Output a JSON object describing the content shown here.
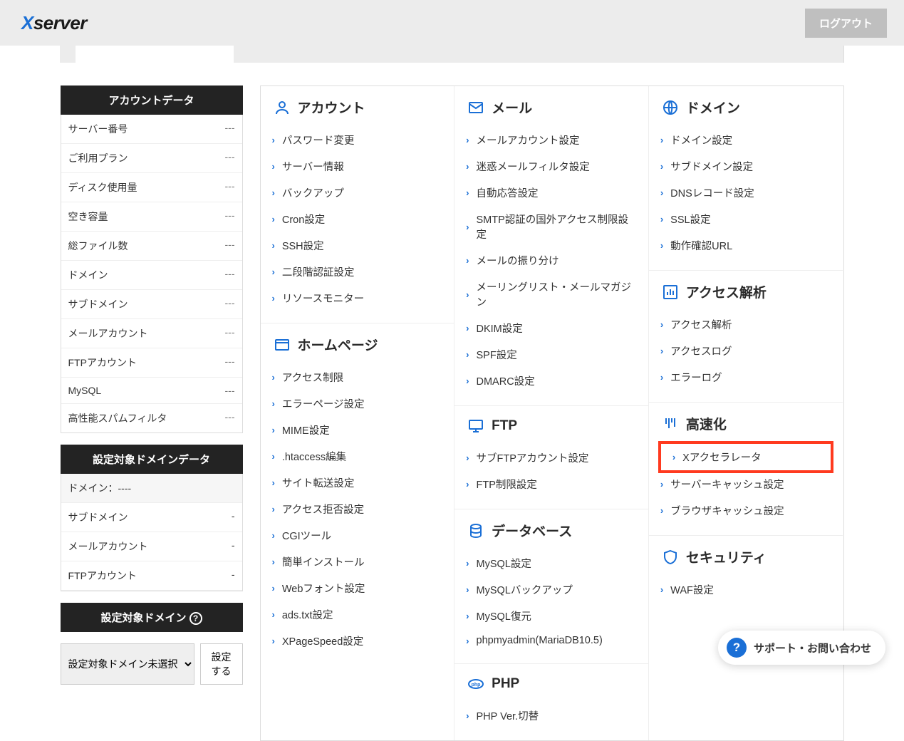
{
  "header": {
    "logo_pre": "X",
    "logo_post": "server",
    "logout": "ログアウト"
  },
  "sidebar": {
    "account_h": "アカウントデータ",
    "account": [
      {
        "k": "サーバー番号",
        "v": "---"
      },
      {
        "k": "ご利用プラン",
        "v": "---"
      },
      {
        "k": "ディスク使用量",
        "v": "---"
      },
      {
        "k": "空き容量",
        "v": "---"
      },
      {
        "k": "総ファイル数",
        "v": "---"
      },
      {
        "k": "ドメイン",
        "v": "---"
      },
      {
        "k": "サブドメイン",
        "v": "---"
      },
      {
        "k": "メールアカウント",
        "v": "---"
      },
      {
        "k": "FTPアカウント",
        "v": "---"
      },
      {
        "k": "MySQL",
        "v": "---"
      },
      {
        "k": "高性能スパムフィルタ",
        "v": "---"
      }
    ],
    "domdata_h": "設定対象ドメインデータ",
    "domdata": [
      {
        "k": "ドメイン：----",
        "v": ""
      },
      {
        "k": "サブドメイン",
        "v": "-"
      },
      {
        "k": "メールアカウント",
        "v": "-"
      },
      {
        "k": "FTPアカウント",
        "v": "-"
      }
    ],
    "target_h": "設定対象ドメイン",
    "select_placeholder": "設定対象ドメイン未選択",
    "set_btn": "設定する"
  },
  "groups": {
    "col1": [
      {
        "title": "アカウント",
        "icon": "user",
        "links": [
          "パスワード変更",
          "サーバー情報",
          "バックアップ",
          "Cron設定",
          "SSH設定",
          "二段階認証設定",
          "リソースモニター"
        ]
      },
      {
        "title": "ホームページ",
        "icon": "browser",
        "links": [
          "アクセス制限",
          "エラーページ設定",
          "MIME設定",
          ".htaccess編集",
          "サイト転送設定",
          "アクセス拒否設定",
          "CGIツール",
          "簡単インストール",
          "Webフォント設定",
          "ads.txt設定",
          "XPageSpeed設定"
        ]
      }
    ],
    "col2": [
      {
        "title": "メール",
        "icon": "mail",
        "links": [
          "メールアカウント設定",
          "迷惑メールフィルタ設定",
          "自動応答設定",
          "SMTP認証の国外アクセス制限設定",
          "メールの振り分け",
          "メーリングリスト・メールマガジン",
          "DKIM設定",
          "SPF設定",
          "DMARC設定"
        ]
      },
      {
        "title": "FTP",
        "icon": "monitor",
        "links": [
          "サブFTPアカウント設定",
          "FTP制限設定"
        ]
      },
      {
        "title": "データベース",
        "icon": "database",
        "links": [
          "MySQL設定",
          "MySQLバックアップ",
          "MySQL復元",
          "phpmyadmin(MariaDB10.5)"
        ]
      },
      {
        "title": "PHP",
        "icon": "php",
        "links": [
          "PHP Ver.切替"
        ]
      }
    ],
    "col3": [
      {
        "title": "ドメイン",
        "icon": "globe",
        "links": [
          "ドメイン設定",
          "サブドメイン設定",
          "DNSレコード設定",
          "SSL設定",
          "動作確認URL"
        ]
      },
      {
        "title": "アクセス解析",
        "icon": "chart",
        "links": [
          "アクセス解析",
          "アクセスログ",
          "エラーログ"
        ]
      },
      {
        "title": "高速化",
        "icon": "speed",
        "links": [
          "Xアクセラレータ",
          "サーバーキャッシュ設定",
          "ブラウザキャッシュ設定"
        ],
        "highlight": 0
      },
      {
        "title": "セキュリティ",
        "icon": "shield",
        "links": [
          "WAF設定"
        ]
      }
    ]
  },
  "support": "サポート・お問い合わせ"
}
